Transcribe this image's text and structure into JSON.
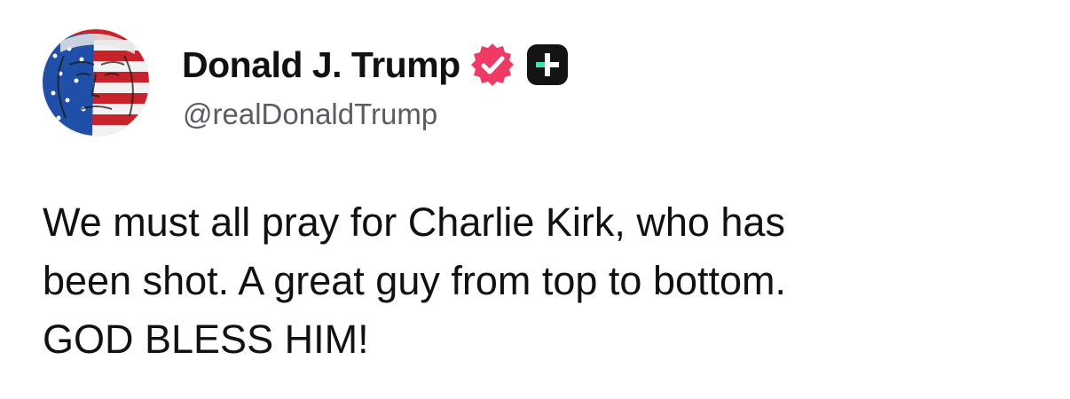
{
  "post": {
    "author": {
      "display_name": "Donald J. Trump",
      "handle": "@realDonaldTrump",
      "verified_icon": "verified-check-icon",
      "badge_icon": "plus-badge-icon",
      "avatar_icon": "profile-avatar"
    },
    "body_lines": [
      "We must all pray for Charlie Kirk, who has",
      "been shot. A great guy from top to bottom.",
      "GOD BLESS HIM!"
    ]
  },
  "colors": {
    "verified": "#ee3a64",
    "badge_bg": "#141414",
    "badge_accent": "#3ee3b4",
    "text": "#111111",
    "handle": "#5b5b66"
  }
}
